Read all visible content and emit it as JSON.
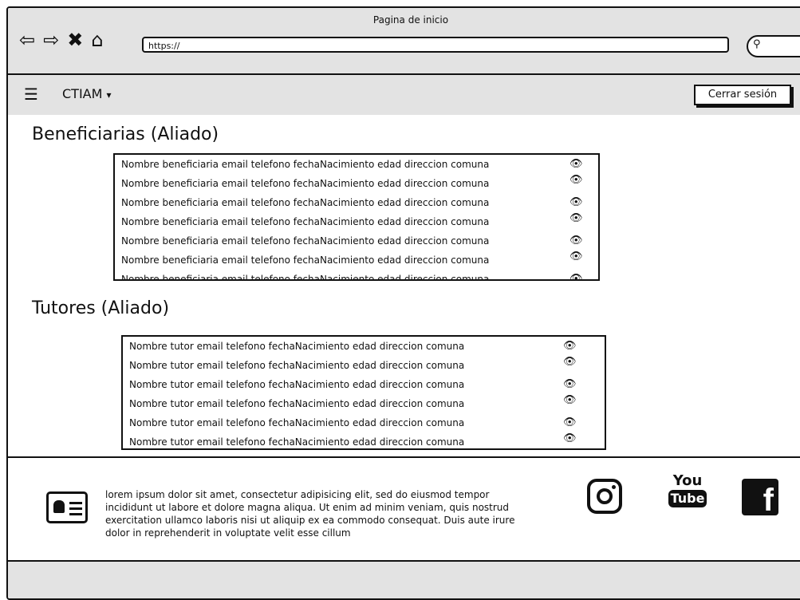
{
  "window": {
    "title": "Pagina de inicio",
    "url": "https://"
  },
  "nav": {
    "menu_icon": "hamburger-icon",
    "brand": "CTIAM",
    "brand_caret": "▾",
    "logout": "Cerrar sesión"
  },
  "sections": {
    "beneficiarias": {
      "title": "Beneficiarias (Aliado)",
      "rows": [
        "Nombre beneficiaria email telefono fechaNacimiento edad direccion  comuna",
        "Nombre beneficiaria email telefono fechaNacimiento edad direccion  comuna",
        "Nombre beneficiaria email telefono fechaNacimiento edad direccion  comuna",
        "Nombre beneficiaria email telefono fechaNacimiento edad direccion  comuna",
        "Nombre beneficiaria email telefono fechaNacimiento edad direccion  comuna",
        "Nombre beneficiaria email telefono fechaNacimiento edad direccion  comuna",
        "Nombre beneficiaria email telefono fechaNacimiento edad direccion  comuna"
      ]
    },
    "tutores": {
      "title": "Tutores (Aliado)",
      "rows": [
        "Nombre tutor   email telefono fechaNacimiento edad direccion  comuna",
        "Nombre tutor   email telefono fechaNacimiento edad direccion  comuna",
        "Nombre tutor   email telefono fechaNacimiento edad direccion  comuna",
        "Nombre tutor   email telefono fechaNacimiento edad direccion  comuna",
        "Nombre tutor   email telefono fechaNacimiento edad direccion  comuna",
        "Nombre tutor   email telefono fechaNacimiento edad direccion  comuna"
      ]
    }
  },
  "footer": {
    "text": "lorem ipsum dolor sit amet, consectetur adipisicing elit, sed do eiusmod tempor incididunt ut labore et dolore magna aliqua. Ut enim ad minim veniam, quis nostrud exercitation ullamco laboris nisi ut aliquip ex ea commodo consequat. Duis aute irure dolor in reprehenderit in voluptate velit esse cillum",
    "youtube_top": "You",
    "youtube_bottom": "Tube",
    "facebook": "f"
  },
  "icons": {
    "eye": "eye-icon",
    "back": "back-arrow-icon",
    "forward": "forward-arrow-icon",
    "stop": "close-icon",
    "home": "home-icon",
    "search": "search-icon",
    "id_card": "id-card-icon",
    "instagram": "instagram-icon",
    "youtube": "youtube-icon",
    "facebook": "facebook-icon"
  }
}
